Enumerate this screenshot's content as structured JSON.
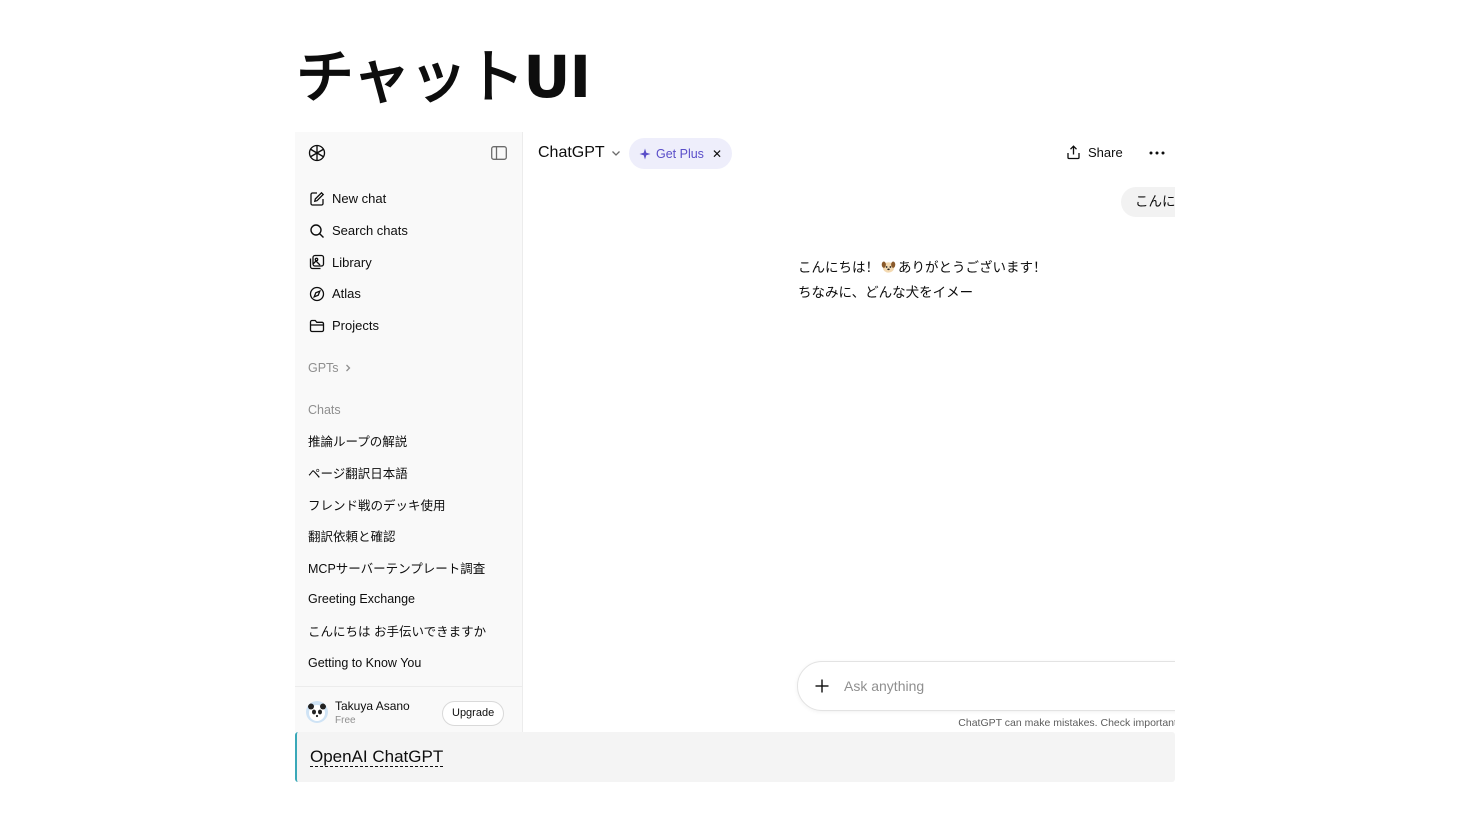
{
  "page": {
    "title": "チャットUI",
    "caption": "OpenAI ChatGPT"
  },
  "sidebar": {
    "nav": [
      {
        "label": "New chat",
        "icon": "edit-icon"
      },
      {
        "label": "Search chats",
        "icon": "search-icon"
      },
      {
        "label": "Library",
        "icon": "library-icon"
      },
      {
        "label": "Atlas",
        "icon": "compass-icon"
      },
      {
        "label": "Projects",
        "icon": "folder-icon"
      }
    ],
    "gpts_label": "GPTs",
    "chats_label": "Chats",
    "chats": [
      "推論ループの解説",
      "ページ翻訳日本語",
      "フレンド戦のデッキ使用",
      "翻訳依頼と確認",
      "MCPサーバーテンプレート調査",
      "Greeting Exchange",
      "こんにちは お手伝いできますか",
      "Getting to Know You"
    ],
    "user": {
      "name": "Takuya Asano",
      "plan": "Free",
      "upgrade_label": "Upgrade"
    }
  },
  "header": {
    "model": "ChatGPT",
    "get_plus": "Get Plus",
    "share": "Share"
  },
  "conversation": {
    "user_message": "こんにちは、かわいい犬ですね。",
    "assistant_line1_before": "こんにちは！",
    "assistant_line1_after": "ありがとうございます！",
    "assistant_line2": "ちなみに、どんな犬をイメー"
  },
  "composer": {
    "placeholder": "Ask anything",
    "disclaimer": "ChatGPT can make mistakes. Check important info."
  },
  "colors": {
    "accent": "#5a4ec9",
    "focus_ring": "#1a73e8",
    "caption_border": "#3aa8b8"
  }
}
